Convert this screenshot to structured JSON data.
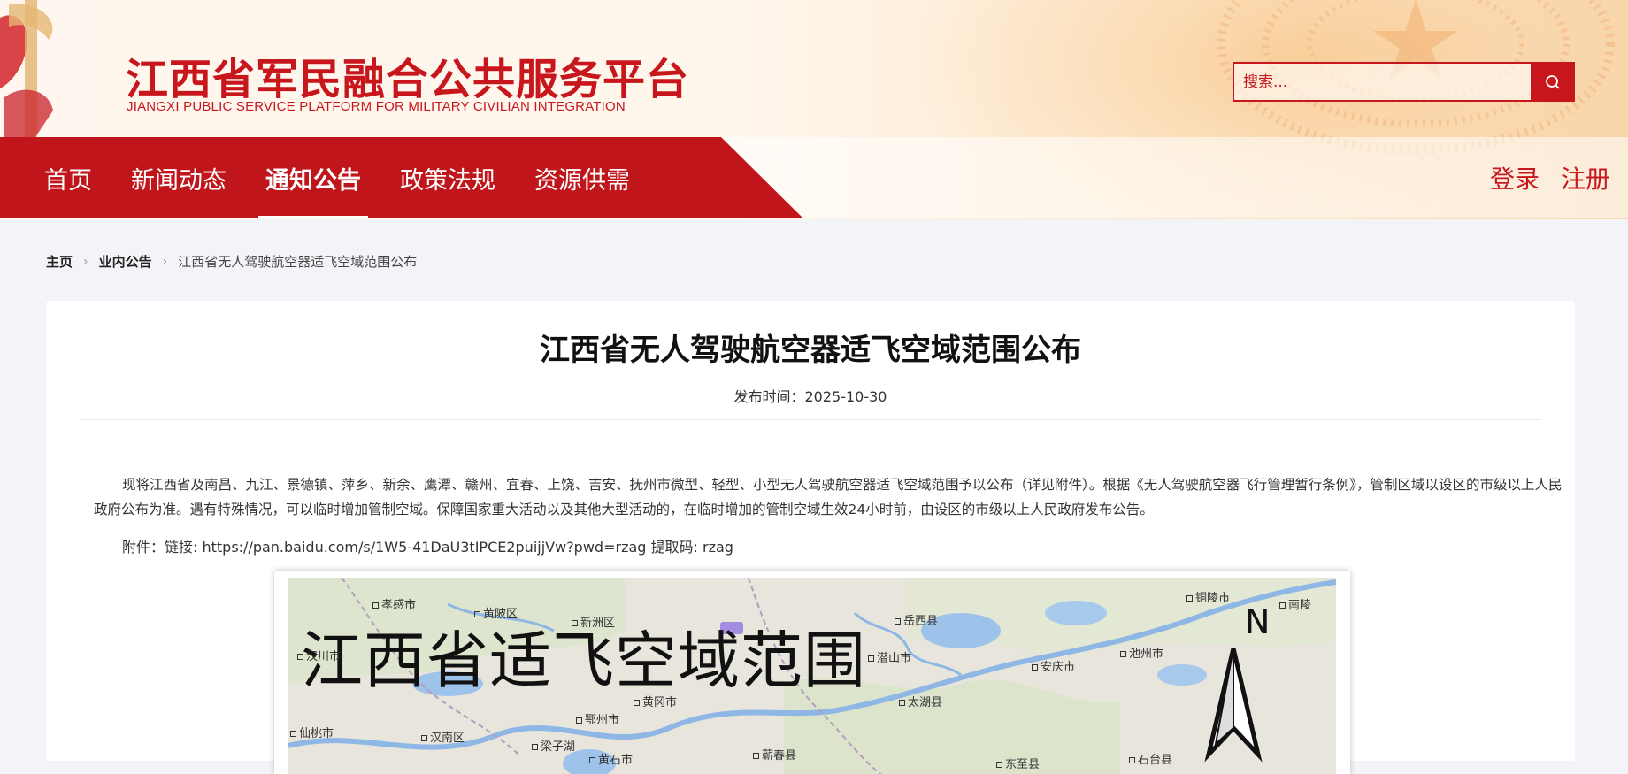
{
  "site": {
    "title": "江西省军民融合公共服务平台",
    "subtitle": "JIANGXI PUBLIC SERVICE PLATFORM FOR MILITARY CIVILIAN INTEGRATION"
  },
  "search": {
    "placeholder": "搜索..."
  },
  "nav": {
    "items": [
      {
        "label": "首页"
      },
      {
        "label": "新闻动态"
      },
      {
        "label": "通知公告",
        "active": true
      },
      {
        "label": "政策法规"
      },
      {
        "label": "资源供需"
      }
    ],
    "login": "登录",
    "register": "注册"
  },
  "breadcrumb": {
    "home": "主页",
    "section": "业内公告",
    "current": "江西省无人驾驶航空器适飞空域范围公布"
  },
  "article": {
    "title": "江西省无人驾驶航空器适飞空域范围公布",
    "date": "发布时间：2025-10-30",
    "paragraph": "现将江西省及南昌、九江、景德镇、萍乡、新余、鹰潭、赣州、宜春、上饶、吉安、抚州市微型、轻型、小型无人驾驶航空器适飞空域范围予以公布（详见附件）。根据《无人驾驶航空器飞行管理暂行条例》，管制区域以设区的市级以上人民政府公布为准。遇有特殊情况，可以临时增加管制空域。保障国家重大活动以及其他大型活动的，在临时增加的管制空域生效24小时前，由设区的市级以上人民政府发布公告。",
    "attachment": "附件：链接: https://pan.baidu.com/s/1W5-41DaU3tIPCE2puijjVw?pwd=rzag 提取码: rzag"
  },
  "map": {
    "title": "江西省适飞空域范围",
    "north": "N",
    "cities": [
      "孝感市",
      "黄陂区",
      "新洲区",
      "岳西县",
      "铜陵市",
      "南陵",
      "汉川市",
      "潜山市",
      "安庆市",
      "池州市",
      "黄冈市",
      "鄂州市",
      "太湖县",
      "仙桃市",
      "汉南区",
      "梁子湖",
      "黄石市",
      "蕲春县",
      "东至县",
      "石台县"
    ]
  },
  "colors": {
    "brand_red": "#c8161d",
    "nav_red": "#c0161b",
    "page_bg": "#f3f4f7"
  }
}
